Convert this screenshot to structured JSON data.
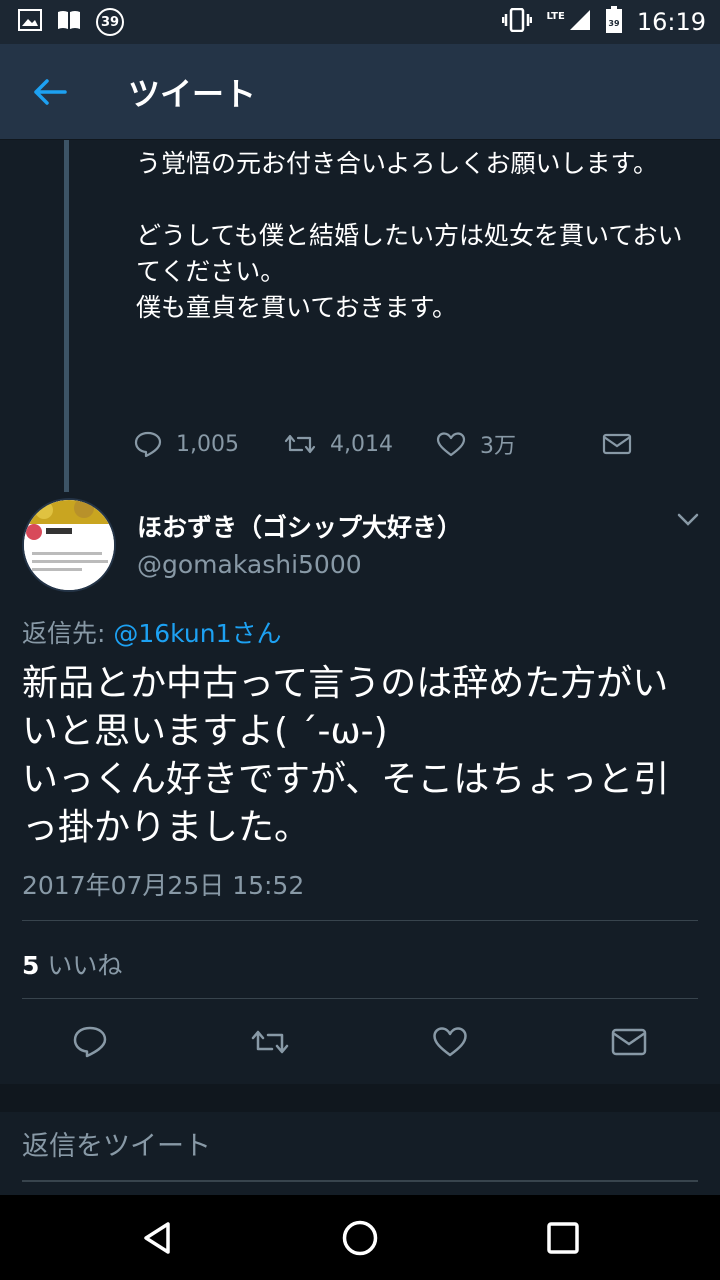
{
  "status_bar": {
    "notification_count": "39",
    "lte_label": "LTE",
    "battery_level": "39",
    "time": "16:19"
  },
  "header": {
    "title": "ツイート"
  },
  "previous_tweet": {
    "text": "しかし結婚が\"絶対あり得ない\"お付き合いだという覚悟の元お付き合いよろしくお願いします。\n\nどうしても僕と結婚したい方は処女を貫いておいてください。\n僕も童貞を貫いておきます。",
    "replies": "1,005",
    "retweets": "4,014",
    "likes": "3万"
  },
  "tweet": {
    "author_name": "ほおずき（ゴシップ大好き）",
    "author_handle": "@gomakashi5000",
    "reply_prefix": "返信先: ",
    "reply_mention": "@16kun1さん",
    "text": "新品とか中古って言うのは辞めた方がいいと思いますよ( ´-ω-)\nいっくん好きですが、そこはちょっと引っ掛かりました。",
    "timestamp": "2017年07月25日 15:52",
    "like_count": "5",
    "like_label": "いいね"
  },
  "reply_box": {
    "placeholder": "返信をツイート"
  },
  "colors": {
    "background": "#141d26",
    "header": "#243447",
    "accent": "#1da1f2",
    "muted": "#8899a6"
  }
}
